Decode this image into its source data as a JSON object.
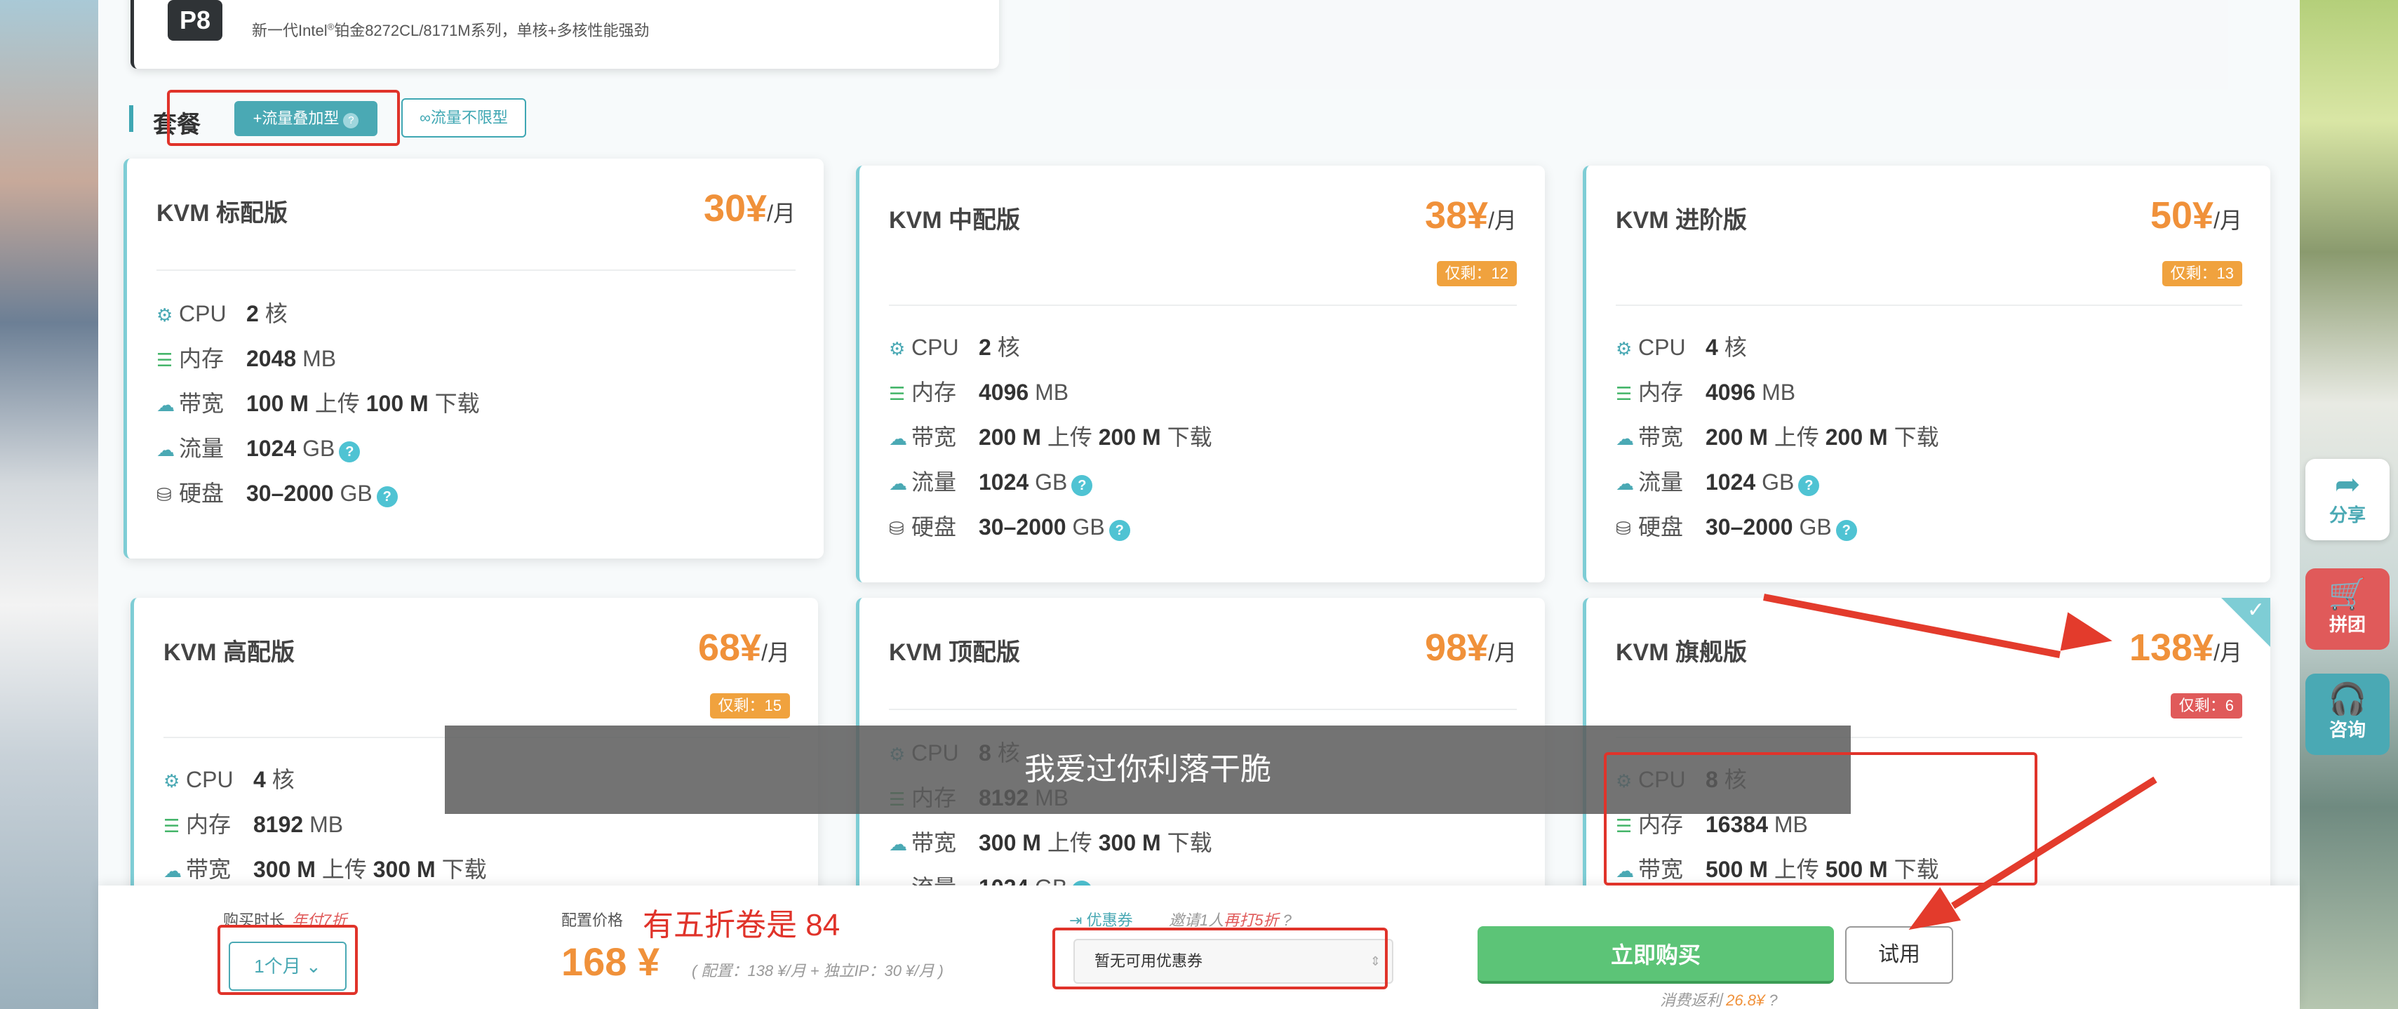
{
  "processor": {
    "badge": "P8",
    "desc_prefix": "新一代Intel",
    "desc_reg": "®",
    "desc_suffix": "铂金8272CL/8171M系列，单核+多核性能强劲"
  },
  "section": {
    "title": "套餐",
    "tag_traffic": "+流量叠加型",
    "tag_unlimited": "∞流量不限型"
  },
  "plans": [
    {
      "name": "KVM 标配版",
      "price": "30¥",
      "unit": "/月",
      "stock": "",
      "cpu": "2",
      "mem": "2048",
      "bw_up": "100 M",
      "bw_down": "100 M",
      "traffic": "1024",
      "disk": "30–2000"
    },
    {
      "name": "KVM 中配版",
      "price": "38¥",
      "unit": "/月",
      "stock": "仅剩：12",
      "cpu": "2",
      "mem": "4096",
      "bw_up": "200 M",
      "bw_down": "200 M",
      "traffic": "1024",
      "disk": "30–2000"
    },
    {
      "name": "KVM 进阶版",
      "price": "50¥",
      "unit": "/月",
      "stock": "仅剩：13",
      "cpu": "4",
      "mem": "4096",
      "bw_up": "200 M",
      "bw_down": "200 M",
      "traffic": "1024",
      "disk": "30–2000"
    },
    {
      "name": "KVM 高配版",
      "price": "68¥",
      "unit": "/月",
      "stock": "仅剩：15",
      "cpu": "4",
      "mem": "8192",
      "bw_up": "300 M",
      "bw_down": "300 M"
    },
    {
      "name": "KVM 顶配版",
      "price": "98¥",
      "unit": "/月",
      "stock": "",
      "cpu": "8",
      "mem": "8192",
      "bw_up": "300 M",
      "bw_down": "300 M",
      "traffic": "1024"
    },
    {
      "name": "KVM 旗舰版",
      "price": "138¥",
      "unit": "/月",
      "stock": "仅剩：6",
      "cpu": "8",
      "mem": "16384",
      "bw_up": "500 M",
      "bw_down": "500 M"
    }
  ],
  "spec_labels": {
    "cpu": "CPU",
    "cpu_unit": "核",
    "mem": "内存",
    "mem_unit": "MB",
    "bw": "带宽",
    "up": "上传",
    "down": "下载",
    "traffic": "流量",
    "traffic_unit": "GB",
    "disk": "硬盘",
    "disk_unit": "GB",
    "help": "?"
  },
  "sidebar": {
    "share": "分享",
    "group": "拼团",
    "consult": "咨询"
  },
  "subtitle": "我爱过你利落干脆",
  "bottom": {
    "duration_label": "购买时长",
    "duration_hint": "年付7折",
    "duration_value": "1个月",
    "price_label": "配置价格",
    "price_note": "有五折卷是 84",
    "price_value": "168 ¥",
    "price_detail": "( 配置：138 ¥/月 + 独立IP：30 ¥/月 )",
    "coupon_label": "优惠券",
    "coupon_invite_prefix": "邀请1人",
    "coupon_invite_em": "再打5折",
    "coupon_value": "暂无可用优惠券",
    "buy": "立即购买",
    "trial": "试用",
    "rebate_prefix": "消费返利",
    "rebate_value": "26.8¥"
  },
  "colors": {
    "accent": "#4aa9b4",
    "price": "#f0913a",
    "buy": "#5cc477",
    "annotation": "#e0332a"
  }
}
